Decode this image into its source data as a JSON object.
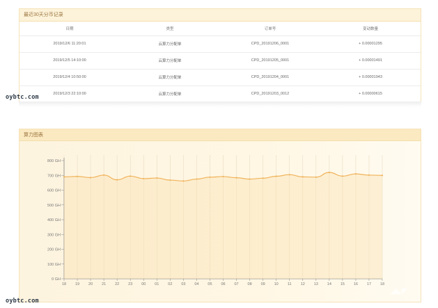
{
  "records": {
    "title": "最近30天分币记录",
    "columns": [
      "日期",
      "类型",
      "订单号",
      "变动数量"
    ],
    "rows": [
      [
        "2019/12/6 11:20:01",
        "云算力分配单",
        "CPD_20191206_0001",
        "+ 0.00001295"
      ],
      [
        "2019/12/5 14:10:00",
        "云算力分配单",
        "CPD_20191205_0001",
        "+ 0.00001491"
      ],
      [
        "2019/12/4 10:50:00",
        "云算力分配单",
        "CPD_20191204_0001",
        "+ 0.00001943"
      ],
      [
        "2019/12/3 22:10:00",
        "云算力分配单",
        "CPD_20191203_0012",
        "+ 0.00000615"
      ]
    ]
  },
  "watermark": "oybtc.com",
  "chart": {
    "title": "算力图表",
    "accent_color": "#f0b35a",
    "grid_color": "#e8dcc4"
  },
  "chart_data": {
    "type": "area",
    "title": "",
    "xlabel": "",
    "ylabel": "",
    "unit": "GH",
    "ylim": [
      0,
      800
    ],
    "yticks": [
      0,
      100,
      200,
      300,
      400,
      500,
      600,
      700,
      800
    ],
    "ytick_labels": [
      "0 GH",
      "100 GH",
      "200 GH",
      "300 GH",
      "400 GH",
      "500 GH",
      "600 GH",
      "700 GH",
      "800 GH"
    ],
    "categories": [
      "18",
      "19",
      "20",
      "21",
      "22",
      "23",
      "00",
      "01",
      "02",
      "03",
      "04",
      "05",
      "06",
      "07",
      "08",
      "09",
      "10",
      "11",
      "12",
      "13",
      "14",
      "15",
      "16",
      "17",
      "18"
    ],
    "values": [
      690,
      693,
      685,
      702,
      670,
      695,
      678,
      682,
      668,
      662,
      675,
      688,
      692,
      684,
      675,
      681,
      694,
      705,
      690,
      688,
      720,
      695,
      710,
      702,
      700
    ]
  }
}
